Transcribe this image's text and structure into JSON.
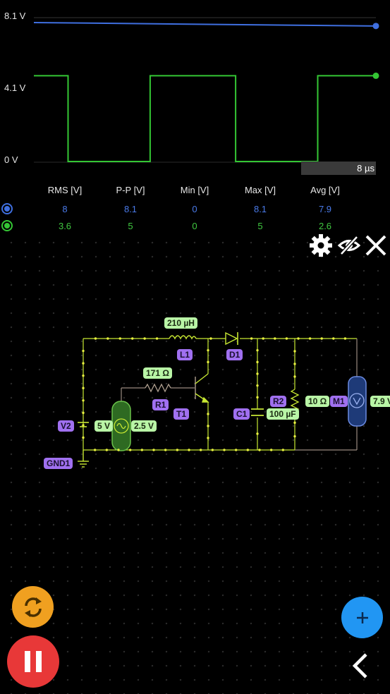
{
  "scope": {
    "y_labels": [
      "8.1 V",
      "4.1 V",
      "0 V"
    ],
    "time_label": "8 µs",
    "stats_headers": [
      "RMS [V]",
      "P-P [V]",
      "Min [V]",
      "Max [V]",
      "Avg [V]"
    ],
    "rows": [
      {
        "color": "#3f6fe0",
        "values": [
          "8",
          "8.1",
          "0",
          "8.1",
          "7.9"
        ]
      },
      {
        "color": "#34c634",
        "values": [
          "3.6",
          "5",
          "0",
          "5",
          "2.6"
        ]
      }
    ]
  },
  "chart_data": {
    "type": "line",
    "ylim": [
      0,
      8.1
    ],
    "y_ticks": [
      "8.1 V",
      "4.1 V",
      "0 V"
    ],
    "x_end_label": "8 µs",
    "series": [
      {
        "color": "#3f6fe0",
        "x": [
          0,
          1
        ],
        "values": [
          8.1,
          7.9
        ]
      },
      {
        "color": "#34c634",
        "x": [
          0,
          0.1,
          0.1,
          0.34,
          0.34,
          0.59,
          0.59,
          0.83,
          0.83,
          1
        ],
        "values": [
          5,
          5,
          0,
          0,
          5,
          5,
          0,
          0,
          5,
          5
        ]
      }
    ]
  },
  "toolbar": {
    "icons": [
      "gear-icon",
      "eye-off-icon",
      "close-icon"
    ]
  },
  "circuit": {
    "labels": {
      "l1_value": "210 µH",
      "l1_name": "L1",
      "d1_name": "D1",
      "r1_value": "171 Ω",
      "r1_name": "R1",
      "t1_name": "T1",
      "c1_name": "C1",
      "c1_value": "100 µF",
      "r2_name": "R2",
      "r2_value": "10 Ω",
      "m1_name": "M1",
      "m1_value": "7.9 V",
      "v2_name": "V2",
      "v2_dc": "5 V",
      "v2_ac": "2.5 V",
      "gnd_name": "GND1"
    }
  },
  "buttons": {
    "refresh": "refresh-icon",
    "pause": "pause-icon",
    "add": "plus-icon",
    "back": "chevron-left-icon"
  }
}
